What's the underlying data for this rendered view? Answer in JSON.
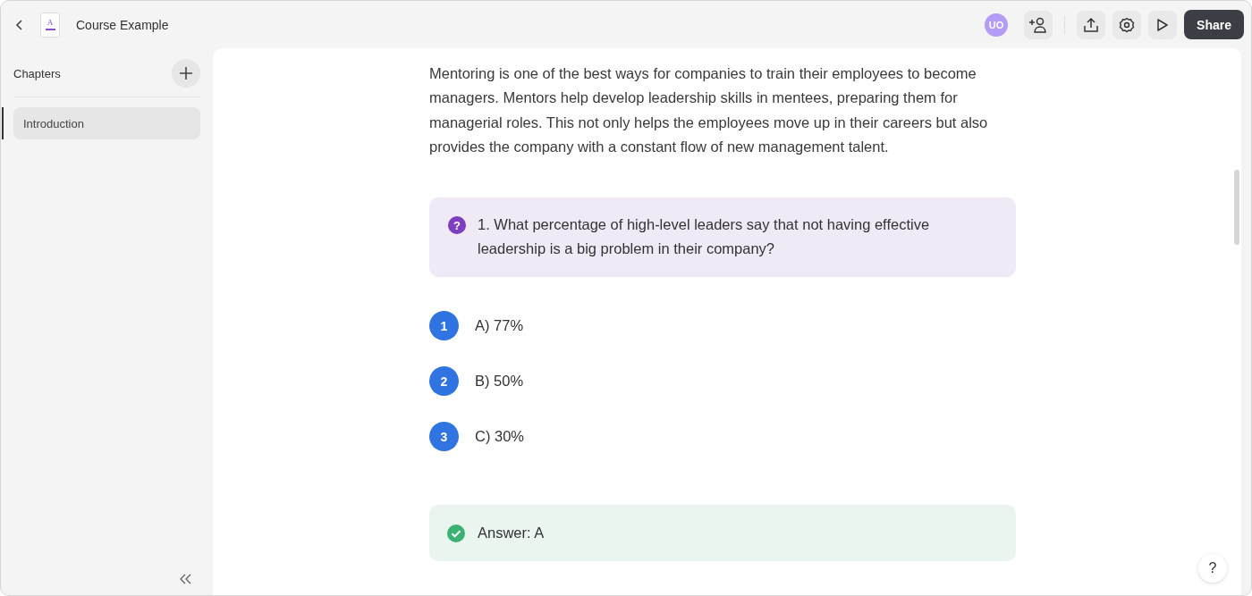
{
  "header": {
    "doc_letter": "A",
    "title": "Course Example",
    "avatar": "UO",
    "share_label": "Share"
  },
  "sidebar": {
    "heading": "Chapters",
    "items": [
      {
        "label": "Introduction",
        "selected": true
      }
    ]
  },
  "content": {
    "paragraph": "Mentoring is one of the best ways for companies to train their employees to become managers. Mentors help develop leadership skills in mentees, preparing them for managerial roles. This not only helps the employees move up in their careers but also provides the company with a constant flow of new management talent.",
    "question": {
      "icon": "?",
      "text": "1. What percentage of high-level leaders say that not having effective leadership is a big problem in their company?"
    },
    "options": [
      {
        "number": "1",
        "label": "A) 77%"
      },
      {
        "number": "2",
        "label": "B) 50%"
      },
      {
        "number": "3",
        "label": "C) 30%"
      }
    ],
    "answer": "Answer: A"
  },
  "help_label": "?"
}
